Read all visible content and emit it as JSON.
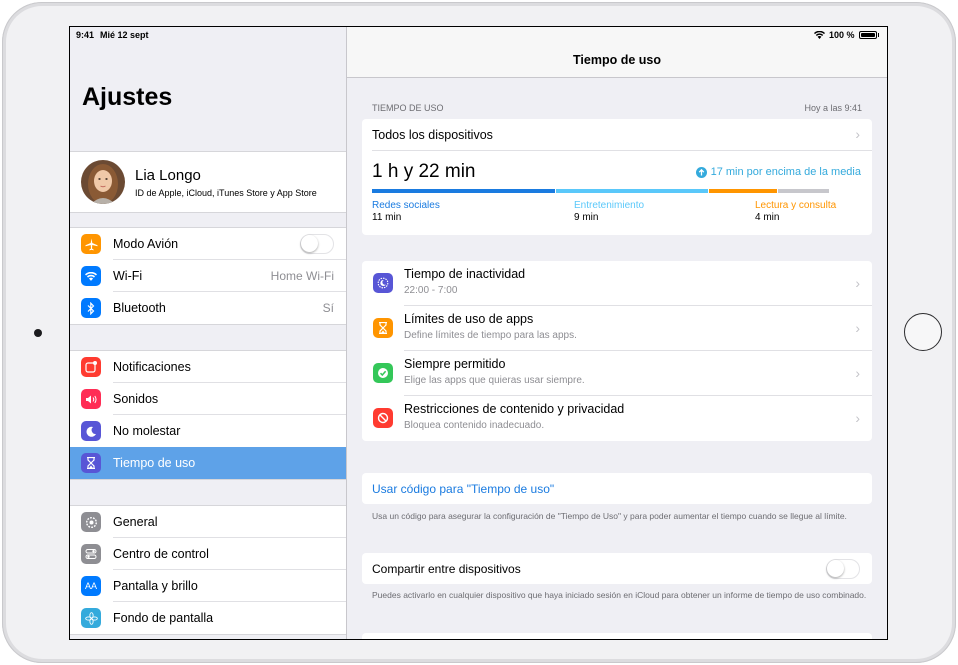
{
  "status_bar": {
    "time": "9:41",
    "date": "Mié 12 sept",
    "battery": "100 %"
  },
  "sidebar": {
    "title": "Ajustes",
    "profile": {
      "name": "Lia Longo",
      "subtitle": "ID de Apple, iCloud, iTunes Store y App Store"
    },
    "group1": [
      {
        "label": "Modo Avión",
        "icon": "airplane-icon",
        "color": "#ff9500",
        "value": "",
        "toggle": true
      },
      {
        "label": "Wi-Fi",
        "icon": "wifi-icon",
        "color": "#007aff",
        "value": "Home Wi-Fi"
      },
      {
        "label": "Bluetooth",
        "icon": "bluetooth-icon",
        "color": "#007aff",
        "value": "Sí"
      }
    ],
    "group2": [
      {
        "label": "Notificaciones",
        "icon": "notifications-icon",
        "color": "#ff3b30"
      },
      {
        "label": "Sonidos",
        "icon": "sounds-icon",
        "color": "#ff2d55"
      },
      {
        "label": "No molestar",
        "icon": "moon-icon",
        "color": "#5856d6"
      },
      {
        "label": "Tiempo de uso",
        "icon": "hourglass-icon",
        "color": "#5856d6",
        "selected": true
      }
    ],
    "group3": [
      {
        "label": "General",
        "icon": "gear-icon",
        "color": "#8e8e93"
      },
      {
        "label": "Centro de control",
        "icon": "control-center-icon",
        "color": "#8e8e93"
      },
      {
        "label": "Pantalla y brillo",
        "icon": "display-icon",
        "color": "#007aff"
      },
      {
        "label": "Fondo de pantalla",
        "icon": "wallpaper-icon",
        "color": "#34aadc"
      }
    ]
  },
  "detail": {
    "nav_title": "Tiempo de uso",
    "section_header": "TIEMPO DE USO",
    "section_time": "Hoy a las 9:41",
    "all_devices": "Todos los dispositivos",
    "total": "1 h y 22 min",
    "comparison": "17 min por encima de la media",
    "usage_bar": [
      {
        "fraction": 0.375,
        "color": "#1a7be0"
      },
      {
        "fraction": 0.31,
        "color": "#5ac8fa"
      },
      {
        "fraction": 0.14,
        "color": "#ff9500"
      },
      {
        "fraction": 0.105,
        "color": "#c7c7cc"
      }
    ],
    "categories": [
      {
        "name": "Redes sociales",
        "time": "11 min",
        "color": "#1a7be0"
      },
      {
        "name": "Entretenimiento",
        "time": "9 min",
        "color": "#5ac8fa"
      },
      {
        "name": "Lectura y consulta",
        "time": "4 min",
        "color": "#ff9500"
      }
    ],
    "options": [
      {
        "title": "Tiempo de inactividad",
        "subtitle": "22:00 - 7:00",
        "icon": "downtime-icon",
        "color": "#5856d6"
      },
      {
        "title": "Límites de uso de apps",
        "subtitle": "Define límites de tiempo para las apps.",
        "icon": "hourglass-icon",
        "color": "#ff9500"
      },
      {
        "title": "Siempre permitido",
        "subtitle": "Elige las apps que quieras usar siempre.",
        "icon": "checkmark-icon",
        "color": "#34c759"
      },
      {
        "title": "Restricciones de contenido y privacidad",
        "subtitle": "Bloquea contenido inadecuado.",
        "icon": "restriction-icon",
        "color": "#ff3b30"
      }
    ],
    "passcode_link": "Usar código para \"Tiempo de uso\"",
    "passcode_footer": "Usa un código para asegurar la configuración de \"Tiempo de Uso\" y para poder aumentar el tiempo cuando se llegue al límite.",
    "share_label": "Compartir entre dispositivos",
    "share_footer": "Puedes activarlo en cualquier dispositivo que haya iniciado sesión en iCloud para obtener un informe de tiempo de uso combinado."
  }
}
